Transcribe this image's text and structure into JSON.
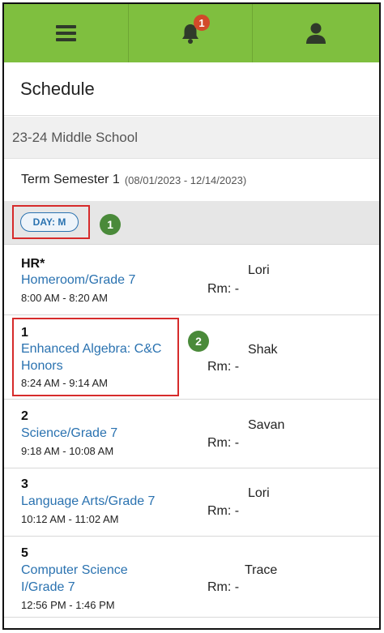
{
  "topbar": {
    "menu_icon": "hamburger-menu-icon",
    "notifications_icon": "bell-icon",
    "notification_count": "1",
    "user_icon": "user-icon",
    "brand_color": "#7fbf3f",
    "badge_color": "#d24a2a"
  },
  "header": {
    "title": "Schedule"
  },
  "school": {
    "name": "23-24 Middle School"
  },
  "term": {
    "name": "Term Semester 1",
    "dates": "(08/01/2023 - 12/14/2023)"
  },
  "day": {
    "label": "DAY: M",
    "callout": "1"
  },
  "periods": [
    {
      "number": "HR*",
      "course": "Homeroom/Grade 7",
      "time": "8:00 AM - 8:20 AM",
      "room": "Rm: -",
      "teacher": "Lori"
    },
    {
      "number": "1",
      "course_line1": "Enhanced Algebra: C&C",
      "course_line2": "Honors",
      "time": "8:24 AM - 9:14 AM",
      "room": "Rm: -",
      "teacher": "Shak",
      "callout": "2"
    },
    {
      "number": "2",
      "course": "Science/Grade 7",
      "time": "9:18 AM - 10:08 AM",
      "room": "Rm: -",
      "teacher": "Savan"
    },
    {
      "number": "3",
      "course": "Language Arts/Grade 7",
      "time": "10:12 AM - 11:02 AM",
      "room": "Rm: -",
      "teacher": "Lori"
    },
    {
      "number": "5",
      "course_line1": "Computer Science",
      "course_line2": "I/Grade 7",
      "time": "12:56 PM - 1:46 PM",
      "room": "Rm: -",
      "teacher": "Trace"
    }
  ],
  "colors": {
    "link": "#2a72b0",
    "highlight_border": "#d62b2b",
    "callout_circle": "#4a8a3a"
  }
}
